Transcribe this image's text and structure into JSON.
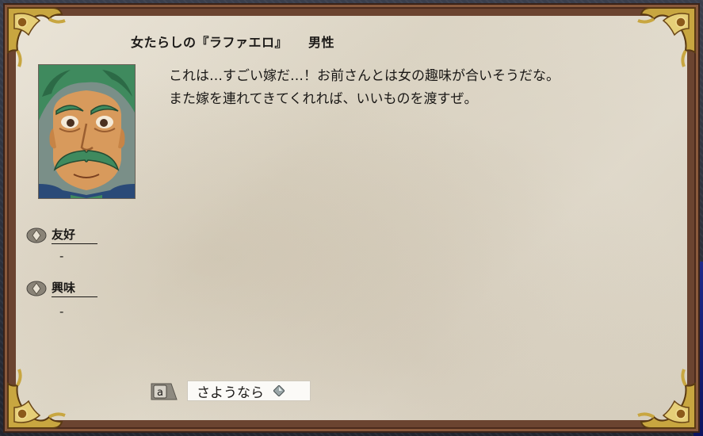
{
  "npc": {
    "title": "女たらしの『ラファエロ』",
    "gender": "男性"
  },
  "dialogue": {
    "lines": [
      "これは…すごい嫁だ…！お前さんとは女の趣味が合いそうだな。",
      "また嫁を連れてきてくれれば、いいものを渡すぜ。"
    ]
  },
  "stats": {
    "friendship_label": "友好",
    "friendship_value": "-",
    "interest_label": "興味",
    "interest_value": "-"
  },
  "choices": [
    {
      "hotkey": "a",
      "label": "さようなら"
    }
  ],
  "colors": {
    "parchment": "#e2dccd",
    "frame": "#6b4430",
    "gold": "#c8a640",
    "portrait_hair": "#3f8a5e"
  },
  "icons": {
    "stat_bullet": "bronze-diamond-icon",
    "choice_gem": "diamond-gem-icon",
    "hotkey_key": "key-cap-icon"
  }
}
